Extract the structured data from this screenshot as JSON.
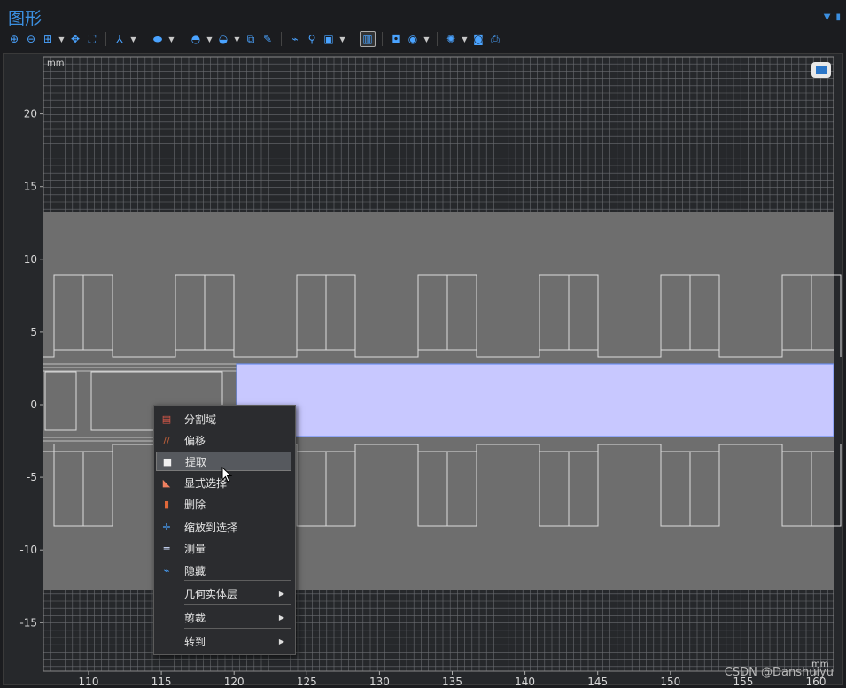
{
  "window": {
    "title": "图形"
  },
  "toolbar_icons": [
    "zoom-in-icon",
    "zoom-out-icon",
    "zoom-box-icon",
    "dropdown",
    "pan-icon",
    "zoom-extents-icon",
    "separator",
    "axis-icon",
    "dropdown",
    "separator",
    "select-domain-icon",
    "dropdown",
    "separator",
    "select-boundary-icon",
    "dropdown",
    "select-all-icon",
    "dropdown",
    "zoom-selection-icon",
    "clear-selection-icon",
    "separator",
    "hide-icon",
    "show-hidden-icon",
    "view-icon",
    "dropdown",
    "separator",
    "wireframe-icon",
    "separator",
    "render-icon",
    "color-icon",
    "dropdown",
    "separator",
    "scene-light-icon",
    "dropdown",
    "camera-icon",
    "print-icon"
  ],
  "plot": {
    "x_unit": "mm",
    "y_unit": "mm",
    "x_ticks": [
      "110",
      "115",
      "120",
      "125",
      "130",
      "135",
      "140",
      "145",
      "150",
      "155",
      "160"
    ],
    "y_ticks": [
      "20",
      "15",
      "10",
      "5",
      "0",
      "-5",
      "-10",
      "-15"
    ]
  },
  "context_menu": {
    "items": [
      {
        "label": "分割域",
        "icon": "partition-icon"
      },
      {
        "label": "偏移",
        "icon": "offset-icon"
      },
      {
        "label": "提取",
        "icon": "extract-icon",
        "highlighted": true
      },
      {
        "label": "显式选择",
        "icon": "explicit-selection-icon"
      },
      {
        "label": "删除",
        "icon": "delete-icon"
      },
      {
        "label": "缩放到选择",
        "icon": "zoom-to-selection-icon"
      },
      {
        "label": "测量",
        "icon": "measure-icon"
      },
      {
        "label": "隐藏",
        "icon": "hide-icon"
      },
      {
        "label": "几何实体层",
        "submenu": true
      },
      {
        "label": "剪裁",
        "submenu": true
      },
      {
        "label": "转到",
        "submenu": true
      }
    ]
  },
  "watermark": "CSDN @Danshuiyu",
  "colors": {
    "accent": "#3b8fe0",
    "geometry_fill": "#6e6e6e",
    "selection_fill": "#c8c8ff"
  }
}
